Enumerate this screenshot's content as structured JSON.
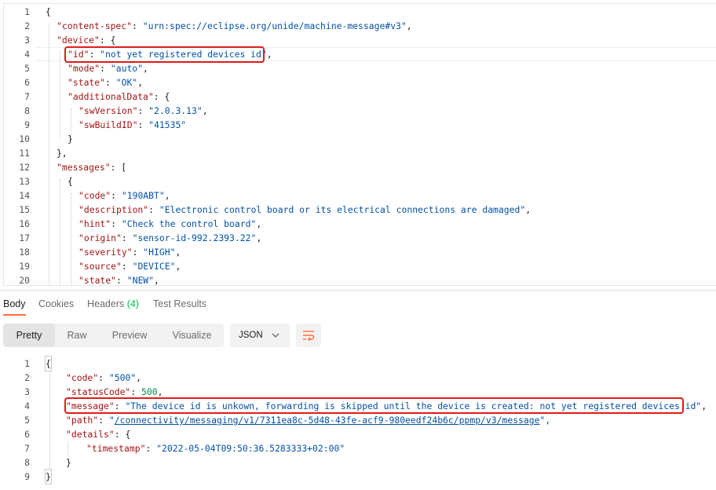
{
  "request_body": {
    "line_numbers": [
      "1",
      "2",
      "3",
      "4",
      "5",
      "6",
      "7",
      "8",
      "9",
      "10",
      "11",
      "12",
      "13",
      "14",
      "15",
      "16",
      "17",
      "18",
      "19",
      "20"
    ],
    "lines": [
      {
        "key": "",
        "text": "{"
      },
      {
        "key": "\"content-spec\"",
        "sep": ": ",
        "val": "\"urn:spec://eclipse.org/unide/machine-message#v3\"",
        "end": ","
      },
      {
        "key": "\"device\"",
        "sep": ": ",
        "val": "",
        "end": "{"
      },
      {
        "key": "\"id\"",
        "sep": ": ",
        "val": "\"not yet registered devices id\"",
        "end": ","
      },
      {
        "key": "\"mode\"",
        "sep": ": ",
        "val": "\"auto\"",
        "end": ","
      },
      {
        "key": "\"state\"",
        "sep": ": ",
        "val": "\"OK\"",
        "end": ","
      },
      {
        "key": "\"additionalData\"",
        "sep": ": ",
        "val": "",
        "end": "{"
      },
      {
        "key": "\"swVersion\"",
        "sep": ": ",
        "val": "\"2.0.3.13\"",
        "end": ","
      },
      {
        "key": "\"swBuildID\"",
        "sep": ": ",
        "val": "\"41535\"",
        "end": ""
      },
      {
        "key": "",
        "text": "}"
      },
      {
        "key": "",
        "text": "},"
      },
      {
        "key": "\"messages\"",
        "sep": ": ",
        "val": "",
        "end": "["
      },
      {
        "key": "",
        "text": "{"
      },
      {
        "key": "\"code\"",
        "sep": ": ",
        "val": "\"190ABT\"",
        "end": ","
      },
      {
        "key": "\"description\"",
        "sep": ": ",
        "val": "\"Electronic control board or its electrical connections are damaged\"",
        "end": ","
      },
      {
        "key": "\"hint\"",
        "sep": ": ",
        "val": "\"Check the control board\"",
        "end": ","
      },
      {
        "key": "\"origin\"",
        "sep": ": ",
        "val": "\"sensor-id-992.2393.22\"",
        "end": ","
      },
      {
        "key": "\"severity\"",
        "sep": ": ",
        "val": "\"HIGH\"",
        "end": ","
      },
      {
        "key": "\"source\"",
        "sep": ": ",
        "val": "\"DEVICE\"",
        "end": ","
      },
      {
        "key": "\"state\"",
        "sep": ": ",
        "val": "\"NEW\"",
        "end": ","
      }
    ]
  },
  "response_tabs": {
    "body": "Body",
    "cookies": "Cookies",
    "headers": "Headers",
    "headers_count": "(4)",
    "test_results": "Test Results"
  },
  "view_modes": {
    "pretty": "Pretty",
    "raw": "Raw",
    "preview": "Preview",
    "visualize": "Visualize",
    "format": "JSON"
  },
  "response_body": {
    "line_numbers": [
      "1",
      "2",
      "3",
      "4",
      "5",
      "6",
      "7",
      "8",
      "9"
    ],
    "open": "{",
    "code_key": "\"code\"",
    "code_val": "\"500\"",
    "status_key": "\"statusCode\"",
    "status_val": "500",
    "message_key": "\"message\"",
    "message_val": "\"The device id is unkown, forwarding is skipped until the device is created: not yet registered devices id\"",
    "path_key": "\"path\"",
    "path_q": "\"",
    "path_val": "/connectivity/messaging/v1/7311ea8c-5d48-43fe-acf9-980eedf24b6c/ppmp/v3/message",
    "path_end": "\",",
    "details_key": "\"details\"",
    "timestamp_key": "\"timestamp\"",
    "timestamp_val": "\"2022-05-04T09:50:36.5283333+02:00\"",
    "close_inner": "}",
    "close": "}"
  },
  "colors": {
    "accent": "#ff6c37",
    "highlight_box": "#e31b1b",
    "count_green": "#0cbb52"
  },
  "icons": [
    "chevron-down-icon",
    "wrap-lines-icon"
  ]
}
